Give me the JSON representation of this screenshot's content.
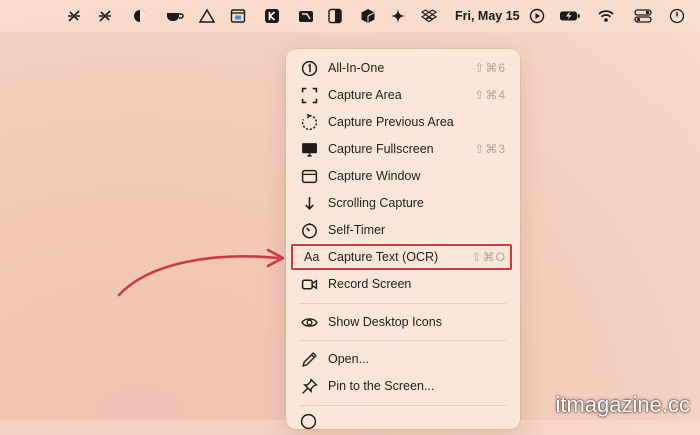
{
  "menubar": {
    "date": "Fri, May 15",
    "icons": [
      "app-tool-icon",
      "app-tool-icon",
      "display-icon",
      "coffee-icon",
      "triangle-icon",
      "window-app-icon",
      "k-app-icon",
      "screenshot-app-icon",
      "split-icon",
      "package-icon",
      "sparkle-icon",
      "dropbox-icon",
      "play-icon",
      "battery-icon",
      "wifi-icon",
      "control-center-icon",
      "clock-icon"
    ]
  },
  "menu": {
    "items": [
      {
        "label": "All-In-One",
        "shortcut": "⇧⌘6",
        "icon": "all-in-one-icon"
      },
      {
        "label": "Capture Area",
        "shortcut": "⇧⌘4",
        "icon": "capture-area-icon"
      },
      {
        "label": "Capture Previous Area",
        "shortcut": "",
        "icon": "previous-area-icon"
      },
      {
        "label": "Capture Fullscreen",
        "shortcut": "⇧⌘3",
        "icon": "fullscreen-icon"
      },
      {
        "label": "Capture Window",
        "shortcut": "",
        "icon": "window-icon"
      },
      {
        "label": "Scrolling Capture",
        "shortcut": "",
        "icon": "arrow-down-icon"
      },
      {
        "label": "Self-Timer",
        "shortcut": "",
        "icon": "timer-icon"
      },
      {
        "label": "Capture Text (OCR)",
        "shortcut": "⇧⌘O",
        "icon": "text-aa-icon"
      },
      {
        "label": "Record Screen",
        "shortcut": "",
        "icon": "record-icon"
      },
      {
        "label": "Show Desktop Icons",
        "shortcut": "",
        "icon": "eye-icon"
      },
      {
        "label": "Open...",
        "shortcut": "",
        "icon": "pencil-icon"
      },
      {
        "label": "Pin to the Screen...",
        "shortcut": "",
        "icon": "pin-icon"
      }
    ],
    "ocr_icon_text": "Aa"
  },
  "colors": {
    "highlight": "#cc3a46",
    "arrow": "#cc3a46",
    "menu_bg": "#fbe7d9"
  },
  "watermark": "itmagazine.cc"
}
